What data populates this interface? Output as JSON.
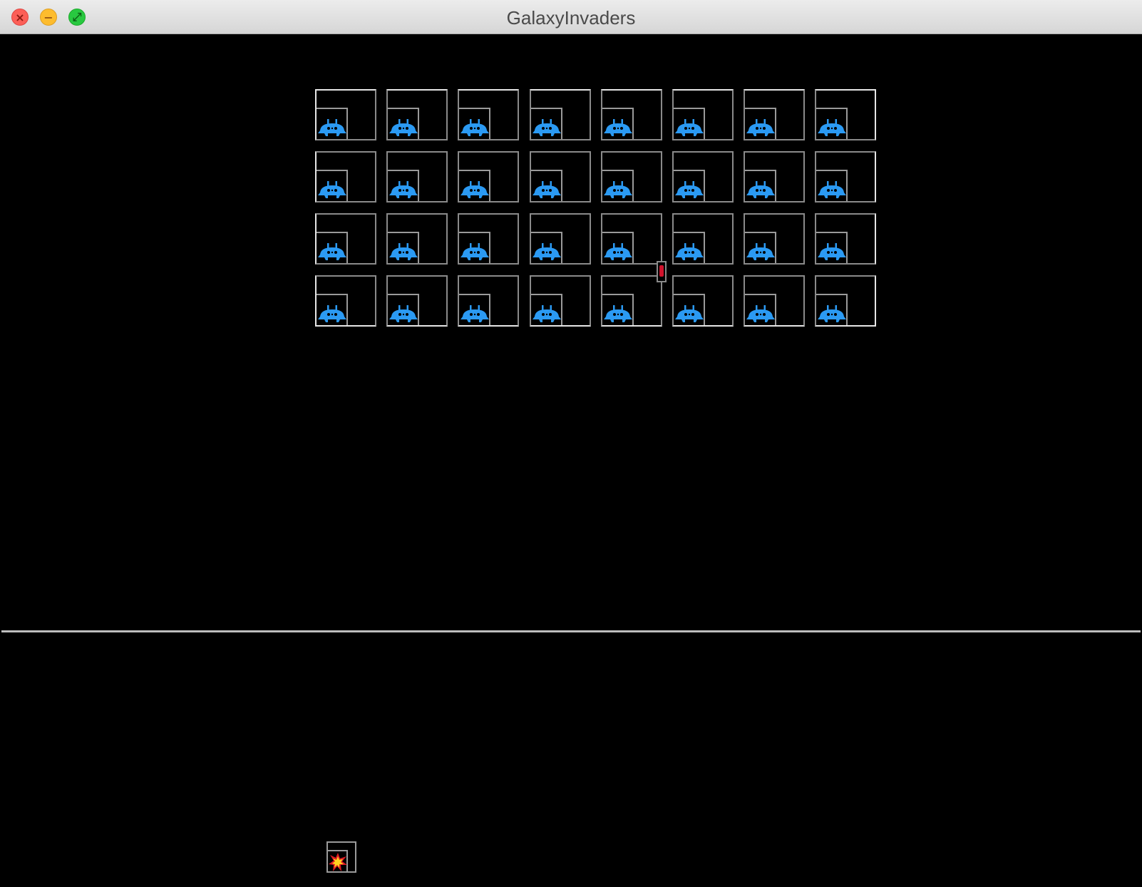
{
  "window": {
    "title": "GalaxyInvaders",
    "controls": [
      "close",
      "minimize",
      "zoom"
    ]
  },
  "game": {
    "background_color": "#000000",
    "invader_color": "#2b9af3",
    "bomb_color": "#d0122b",
    "invader_rows": 4,
    "invader_columns": 8,
    "invader_icon": "invader-icon",
    "bomb_icon": "bomb-icon",
    "player_icon": "explosion-icon"
  }
}
